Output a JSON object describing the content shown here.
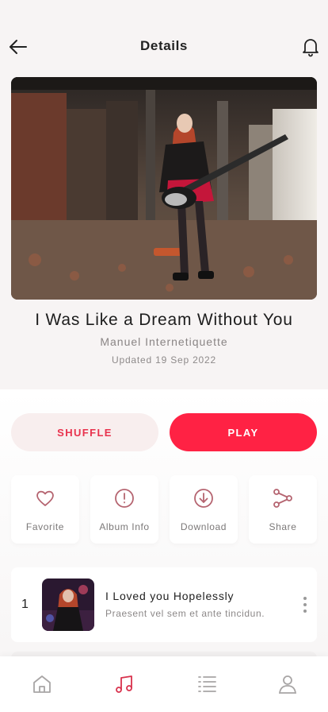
{
  "header": {
    "title": "Details",
    "back_icon": "arrow-left-icon",
    "bell_icon": "bell-icon"
  },
  "album": {
    "title": "I Was Like a Dream Without You",
    "artist": "Manuel Internetiquette",
    "updated": "Updated 19 Sep 2022"
  },
  "buttons": {
    "shuffle": "SHUFFLE",
    "play": "PLAY"
  },
  "actions": [
    {
      "label": "Favorite",
      "icon": "heart-icon"
    },
    {
      "label": "Album Info",
      "icon": "info-circle-icon"
    },
    {
      "label": "Download",
      "icon": "download-icon"
    },
    {
      "label": "Share",
      "icon": "share-icon"
    }
  ],
  "tracks": [
    {
      "number": "1",
      "name": "I Loved you Hopelessly",
      "desc": "Praesent vel sem et ante tincidun."
    }
  ],
  "nav": [
    "home-icon",
    "music-note-icon",
    "list-icon",
    "user-icon"
  ],
  "colors": {
    "accent": "#ff2244",
    "accent_text": "#e8324d",
    "shuffle_bg": "#f8eeee",
    "page_bg": "#f7f4f4"
  }
}
